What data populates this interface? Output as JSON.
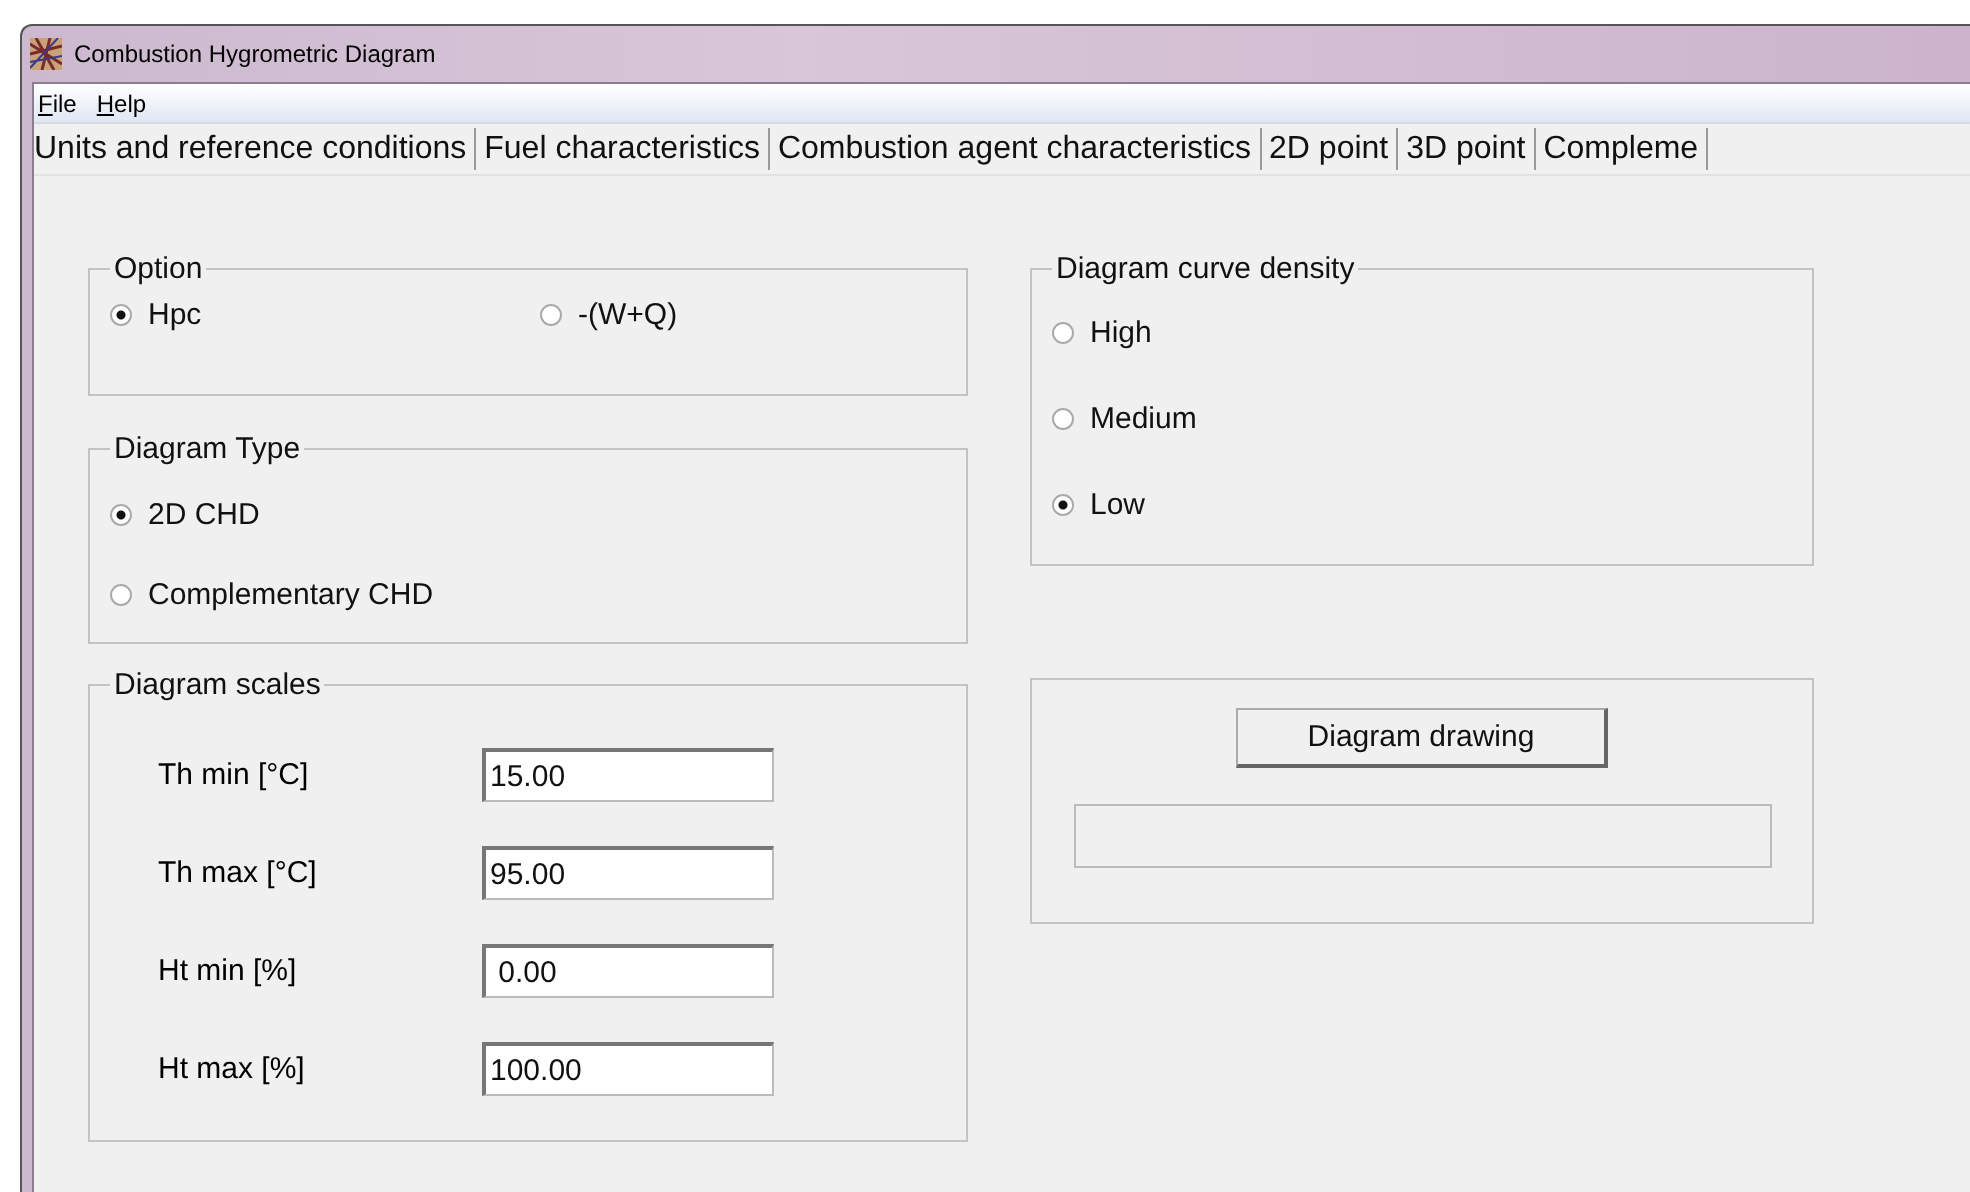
{
  "window": {
    "title": "Combustion Hygrometric Diagram"
  },
  "menu": [
    "File",
    "Help"
  ],
  "tabs": [
    "Units and reference conditions",
    "Fuel characteristics",
    "Combustion agent characteristics",
    "2D point",
    "3D point",
    "Compleme"
  ],
  "option": {
    "title": "Option",
    "options": [
      {
        "label": "Hpc",
        "selected": true
      },
      {
        "label": "-(W+Q)",
        "selected": false
      }
    ]
  },
  "diagram_type": {
    "title": "Diagram Type",
    "options": [
      {
        "label": "2D CHD",
        "selected": true
      },
      {
        "label": "Complementary CHD",
        "selected": false
      }
    ]
  },
  "diagram_scales": {
    "title": "Diagram scales",
    "fields": [
      {
        "label": "Th min [°C]",
        "value": "15.00"
      },
      {
        "label": "Th max [°C]",
        "value": "95.00"
      },
      {
        "label": "Ht min [%]",
        "value": " 0.00"
      },
      {
        "label": "Ht max [%]",
        "value": "100.00"
      }
    ]
  },
  "curve_density": {
    "title": "Diagram curve density",
    "options": [
      {
        "label": "High",
        "selected": false
      },
      {
        "label": "Medium",
        "selected": false
      },
      {
        "label": "Low",
        "selected": true
      }
    ]
  },
  "drawing": {
    "button": "Diagram drawing",
    "progress": {
      "level": 0
    }
  }
}
